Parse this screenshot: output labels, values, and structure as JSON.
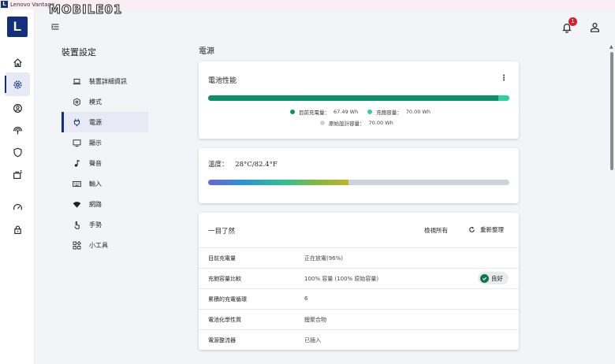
{
  "window": {
    "title": "Lenovo Vantage",
    "logo_letter": "L",
    "watermark": "MOBILE01"
  },
  "rail": {
    "logo_letter": "L",
    "items": [
      {
        "icon": "home-icon"
      },
      {
        "icon": "gear-icon",
        "active": true
      },
      {
        "icon": "account-icon"
      },
      {
        "icon": "wifi-security-icon"
      },
      {
        "icon": "shield-icon"
      },
      {
        "icon": "toolbox-icon"
      },
      {
        "icon": "gauge-icon"
      },
      {
        "icon": "lock-icon"
      }
    ]
  },
  "topbar": {
    "notification_count": "1",
    "colors": {
      "badge": "#d6202f",
      "accent": "#13307f"
    }
  },
  "settings_nav": {
    "title": "裝置設定",
    "items": [
      {
        "label": "裝置詳細資訊",
        "icon": "laptop-icon"
      },
      {
        "label": "模式",
        "icon": "hexagon-icon"
      },
      {
        "label": "電源",
        "icon": "plug-icon",
        "active": true
      },
      {
        "label": "顯示",
        "icon": "monitor-icon"
      },
      {
        "label": "聲音",
        "icon": "music-note-icon"
      },
      {
        "label": "輸入",
        "icon": "keyboard-icon"
      },
      {
        "label": "網路",
        "icon": "wifi-icon"
      },
      {
        "label": "手勢",
        "icon": "hand-icon"
      },
      {
        "label": "小工具",
        "icon": "widgets-icon"
      }
    ]
  },
  "main": {
    "title": "電源",
    "battery_card": {
      "title": "電池性能",
      "current_charge_label": "目前充電量：",
      "current_charge_value": "67.49 Wh",
      "full_capacity_label": "充飽容量：",
      "full_capacity_value": "70.00 Wh",
      "design_capacity_label": "原始設計容量：",
      "design_capacity_value": "70.00 Wh",
      "charge_fraction": 0.964,
      "capacity_fraction": 1.0,
      "colors": {
        "charge": "#0e8f66",
        "capacity": "#2fd0a0",
        "design": "#cfd3d9"
      }
    },
    "temperature_card": {
      "label": "溫度：",
      "value": "28°C/82.4°F",
      "level_fraction": 0.466
    },
    "overview_card": {
      "title": "一目了然",
      "view_all": "檢視所有",
      "refresh": "重新整理",
      "rows": [
        {
          "label": "目前充電量",
          "value": "正在放電(96%)"
        },
        {
          "label": "充飽容量比較",
          "value": "100% 容量 (100% 原始容量)",
          "status": "良好"
        },
        {
          "label": "累積的充電循環",
          "value": "6"
        },
        {
          "label": "電池化學性質",
          "value": "鋰聚合物"
        },
        {
          "label": "電源整流器",
          "value": "已插入"
        }
      ]
    }
  }
}
